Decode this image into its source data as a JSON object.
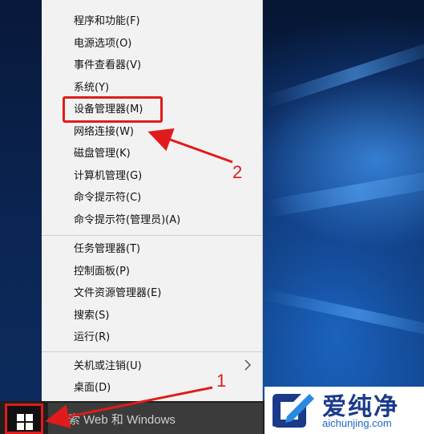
{
  "context_menu": {
    "group1": [
      "程序和功能(F)",
      "电源选项(O)",
      "事件查看器(V)",
      "系统(Y)",
      "设备管理器(M)",
      "网络连接(W)",
      "磁盘管理(K)",
      "计算机管理(G)",
      "命令提示符(C)",
      "命令提示符(管理员)(A)"
    ],
    "group2": [
      "任务管理器(T)",
      "控制面板(P)",
      "文件资源管理器(E)",
      "搜索(S)",
      "运行(R)"
    ],
    "group3": [
      "关机或注销(U)",
      "桌面(D)"
    ]
  },
  "taskbar": {
    "search_placeholder": "搜索 Web 和 Windows"
  },
  "annotations": {
    "label_1": "1",
    "label_2": "2",
    "highlight_color": "#e11b1b"
  },
  "watermark": {
    "title": "爱纯净",
    "url": "aichunjing.com"
  }
}
